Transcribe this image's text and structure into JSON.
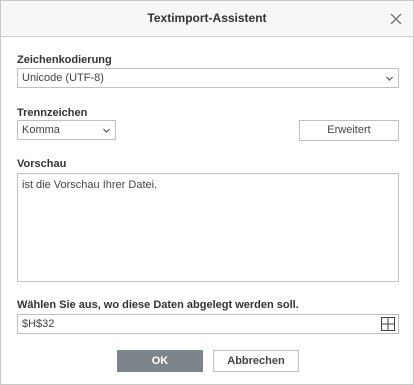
{
  "dialog": {
    "title": "Textimport-Assistent"
  },
  "encoding": {
    "label": "Zeichenkodierung",
    "value": "Unicode (UTF-8)"
  },
  "delimiter": {
    "label": "Trennzeichen",
    "value": "Komma",
    "advanced_label": "Erweitert"
  },
  "preview": {
    "label": "Vorschau",
    "text": "ist die Vorschau Ihrer Datei."
  },
  "destination": {
    "label": "Wählen Sie aus, wo diese Daten abgelegt werden soll.",
    "value": "$H$32"
  },
  "footer": {
    "ok_label": "OK",
    "cancel_label": "Abbrechen"
  },
  "icons": {
    "close": "close-icon",
    "chevron": "chevron-down-icon",
    "range": "select-range-icon"
  }
}
